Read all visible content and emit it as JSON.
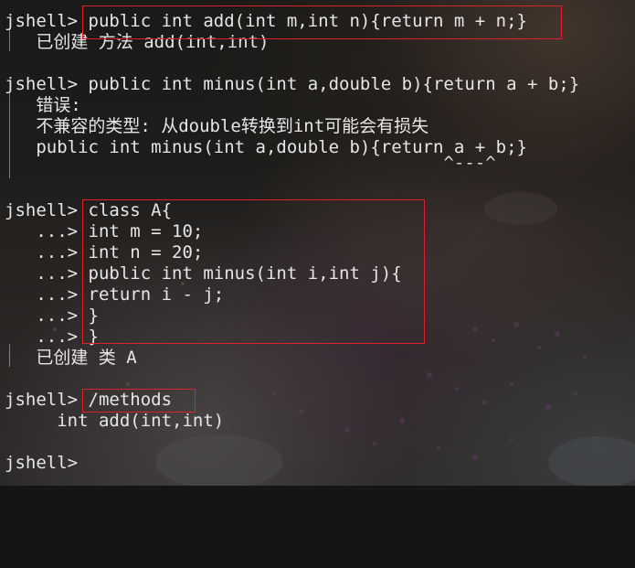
{
  "colors": {
    "text": "#e6e6e6",
    "highlight_box": "#d8232a"
  },
  "prompt": "jshell>",
  "continuation": "   ...>",
  "lines": {
    "l1": "jshell> public int add(int m,int n){return m + n;}",
    "l2": "   已创建 方法 add(int,int)",
    "l3": "jshell> public int minus(int a,double b){return a + b;}",
    "l4": "   错误:",
    "l5": "   不兼容的类型: 从double转换到int可能会有损失",
    "l6": "   public int minus(int a,double b){return a + b;}",
    "l7": "                                          ^---^",
    "l8": "jshell> class A{",
    "l9": "   ...> int m = 10;",
    "l10": "   ...> int n = 20;",
    "l11": "   ...> public int minus(int i,int j){",
    "l12": "   ...> return i - j;",
    "l13": "   ...> }",
    "l14": "   ...> }",
    "l15": "   已创建 类 A",
    "l16": "jshell> /methods",
    "l17": "     int add(int,int)",
    "l18": "jshell>"
  }
}
